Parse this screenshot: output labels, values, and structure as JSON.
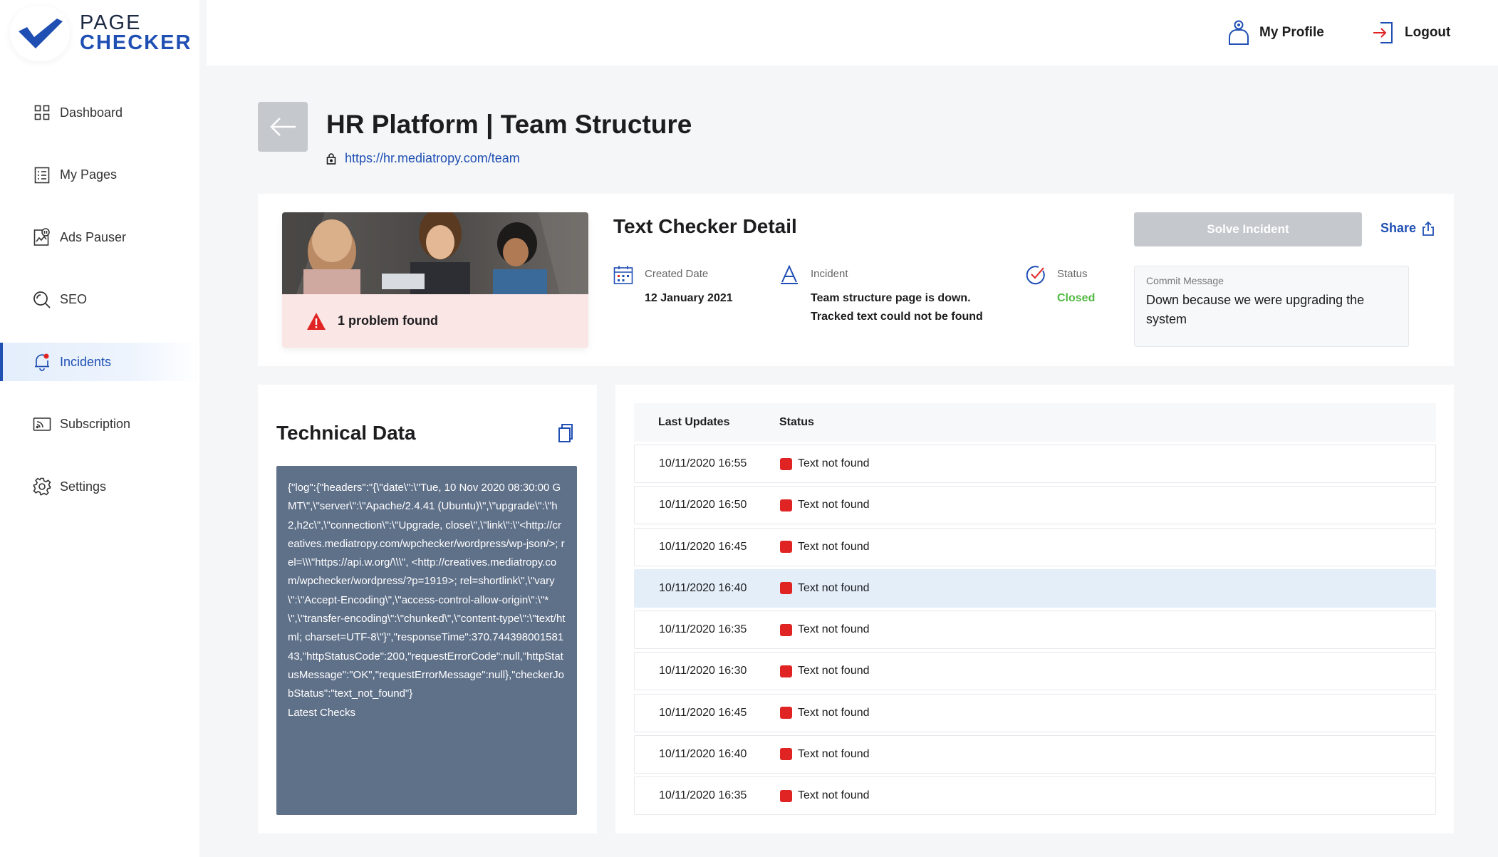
{
  "app": {
    "logo_line1": "PAGE",
    "logo_line2": "CHECKER",
    "brand_color": "#1f4fb3"
  },
  "sidebar": {
    "items": [
      {
        "label": "Dashboard",
        "icon": "grid-icon"
      },
      {
        "label": "My Pages",
        "icon": "pages-icon"
      },
      {
        "label": "Ads Pauser",
        "icon": "ads-pauser-icon"
      },
      {
        "label": "SEO",
        "icon": "search-icon"
      },
      {
        "label": "Incidents",
        "icon": "bell-icon",
        "active": true
      },
      {
        "label": "Subscription",
        "icon": "subscription-icon"
      },
      {
        "label": "Settings",
        "icon": "gear-icon"
      }
    ]
  },
  "header": {
    "profile_label": "My Profile",
    "logout_label": "Logout"
  },
  "page": {
    "title": "HR Platform | Team Structure",
    "url": "https://hr.mediatropy.com/team"
  },
  "detail": {
    "problem_text": "1 problem found",
    "title": "Text Checker Detail",
    "created_label": "Created Date",
    "created_value": "12 January 2021",
    "incident_label": "Incident",
    "incident_line1": "Team structure page is down.",
    "incident_line2": "Tracked text could not be found",
    "status_label": "Status",
    "status_value": "Closed",
    "status_color": "#52b843",
    "solve_label": "Solve Incident",
    "share_label": "Share",
    "commit_label": "Commit Message",
    "commit_text": "Down because we were upgrading the system"
  },
  "technical": {
    "title": "Technical Data",
    "json": "{\"log\":{\"headers\":\"{\\\"date\\\":\\\"Tue, 10 Nov 2020 08:30:00 GMT\\\",\\\"server\\\":\\\"Apache/2.4.41 (Ubuntu)\\\",\\\"upgrade\\\":\\\"h2,h2c\\\",\\\"connection\\\":\\\"Upgrade, close\\\",\\\"link\\\":\\\"<http://creatives.mediatropy.com/wpchecker/wordpress/wp-json/>; rel=\\\\\\\"https://api.w.org/\\\\\\\", <http://creatives.mediatropy.com/wpchecker/wordpress/?p=1919>; rel=shortlink\\\",\\\"vary\\\":\\\"Accept-Encoding\\\",\\\"access-control-allow-origin\\\":\\\"*\\\",\\\"transfer-encoding\\\":\\\"chunked\\\",\\\"content-type\\\":\\\"text/html; charset=UTF-8\\\"}\",\"responseTime\":370.74439800158143,\"httpStatusCode\":200,\"requestErrorCode\":null,\"httpStatusMessage\":\"OK\",\"requestErrorMessage\":null},\"checkerJobStatus\":\"text_not_found\"}",
    "subtitle": "Latest Checks"
  },
  "updates": {
    "col_date": "Last Updates",
    "col_status": "Status",
    "status_color": "#e02424",
    "rows": [
      {
        "date": "10/11/2020 16:55",
        "status": "Text not found"
      },
      {
        "date": "10/11/2020 16:50",
        "status": "Text not found"
      },
      {
        "date": "10/11/2020 16:45",
        "status": "Text not found"
      },
      {
        "date": "10/11/2020 16:40",
        "status": "Text not found",
        "highlighted": true
      },
      {
        "date": "10/11/2020 16:35",
        "status": "Text not found"
      },
      {
        "date": "10/11/2020 16:30",
        "status": "Text not found"
      },
      {
        "date": "10/11/2020 16:45",
        "status": "Text not found"
      },
      {
        "date": "10/11/2020 16:40",
        "status": "Text not found"
      },
      {
        "date": "10/11/2020 16:35",
        "status": "Text not found"
      }
    ]
  }
}
